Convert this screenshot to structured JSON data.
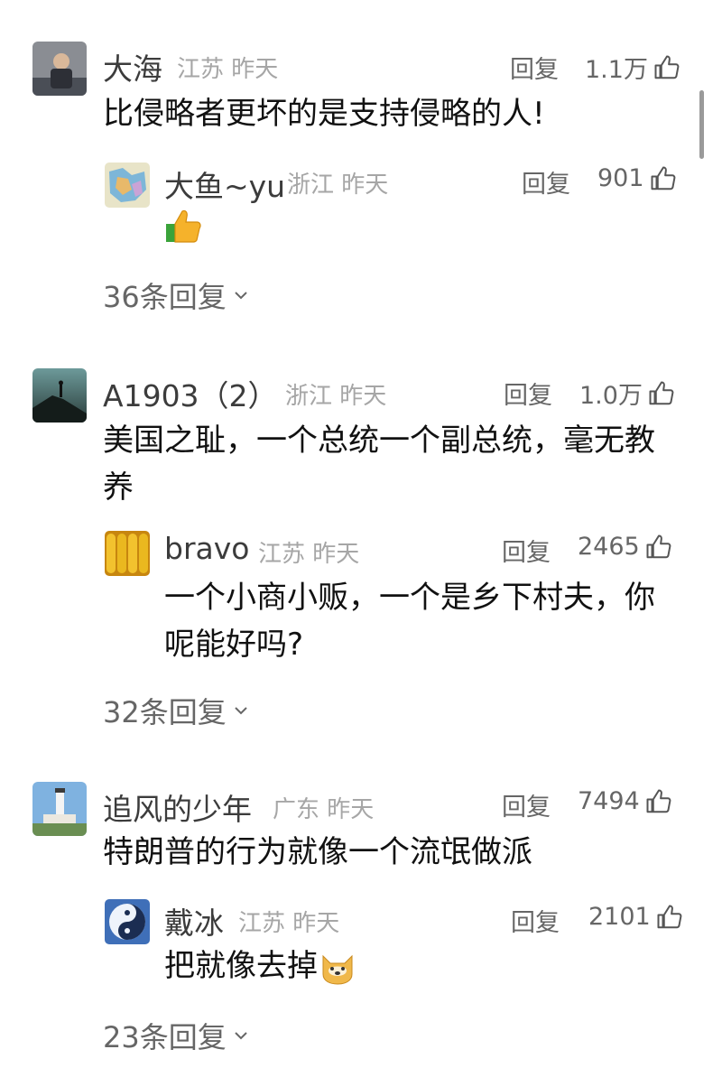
{
  "common": {
    "reply_label": "回复",
    "time_label": "昨天"
  },
  "comments": [
    {
      "user": "大海",
      "region": "江苏",
      "likes": "1.1万",
      "text": "比侵略者更坏的是支持侵略的人!",
      "reply": {
        "user": "大鱼~yu",
        "region": "浙江",
        "likes": "901",
        "text": ""
      },
      "more": "36条回复"
    },
    {
      "user": "A1903（2）",
      "region": "浙江",
      "likes": "1.0万",
      "text": "美国之耻，一个总统一个副总统，毫无教养",
      "reply": {
        "user": "bravo",
        "region": "江苏",
        "likes": "2465",
        "text": "一个小商小贩，一个是乡下村夫，你呢能好吗?"
      },
      "more": "32条回复"
    },
    {
      "user": "追风的少年",
      "region": "广东",
      "likes": "7494",
      "text": "特朗普的行为就像一个流氓做派",
      "reply": {
        "user": "戴冰",
        "region": "江苏",
        "likes": "2101",
        "text": "把就像去掉"
      },
      "more": "23条回复"
    }
  ],
  "icons": {
    "like": "thumbs-up-icon",
    "more": "chevron-down-icon"
  }
}
